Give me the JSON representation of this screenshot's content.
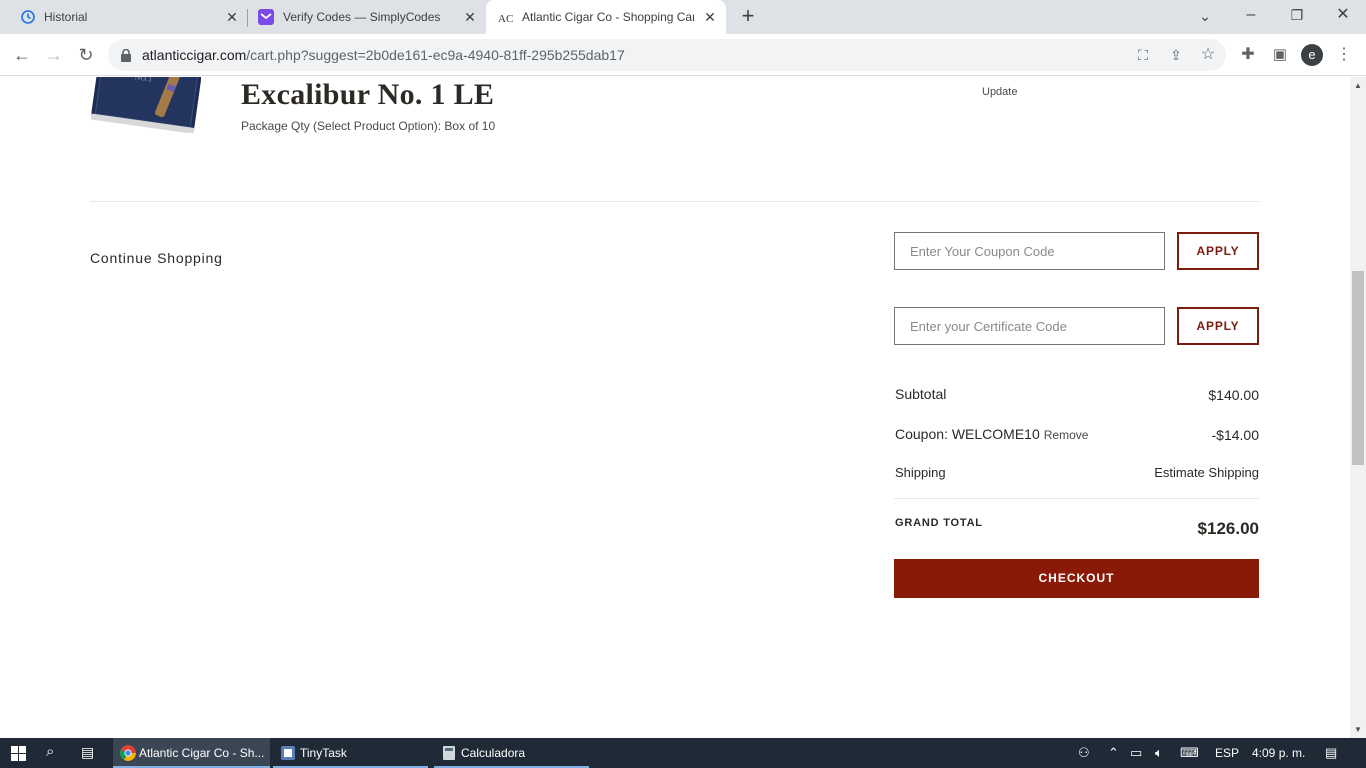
{
  "browser": {
    "tabs": [
      {
        "title": "Historial",
        "icon": "history-icon",
        "active": false
      },
      {
        "title": "Verify Codes — SimplyCodes",
        "icon": "simplycodes-icon",
        "active": false
      },
      {
        "title": "Atlantic Cigar Co - Shopping Car",
        "icon": "atlantic-cigar-icon",
        "active": true
      }
    ],
    "url_host": "atlanticcigar.com",
    "url_rest": "/cart.php?suggest=2b0de161-ec9a-4940-81ff-295b255dab17",
    "profile_initial": "e"
  },
  "product": {
    "name": "Excalibur No. 1 LE",
    "option": "Package Qty (Select Product Option): Box of 10",
    "update_label": "Update"
  },
  "cart": {
    "continue_label": "Continue Shopping",
    "coupon_placeholder": "Enter Your Coupon Code",
    "certificate_placeholder": "Enter your Certificate Code",
    "apply_label": "APPLY",
    "subtotal_label": "Subtotal",
    "subtotal_value": "$140.00",
    "coupon_label": "Coupon: WELCOME10",
    "coupon_remove": "Remove",
    "coupon_value": "-$14.00",
    "shipping_label": "Shipping",
    "shipping_value": "Estimate Shipping",
    "grand_total_label": "GRAND TOTAL",
    "grand_total_value": "$126.00",
    "checkout_label": "CHECKOUT"
  },
  "taskbar": {
    "items": [
      {
        "label": "Atlantic Cigar Co - Sh...",
        "icon": "chrome-icon"
      },
      {
        "label": "TinyTask",
        "icon": "tinytask-icon"
      },
      {
        "label": "Calculadora",
        "icon": "calculator-icon"
      }
    ],
    "language": "ESP",
    "time": "4:09 p. m."
  },
  "colors": {
    "accent": "#8a1a07",
    "taskbar": "#1f2a36",
    "tabstrip": "#dee1e6"
  }
}
